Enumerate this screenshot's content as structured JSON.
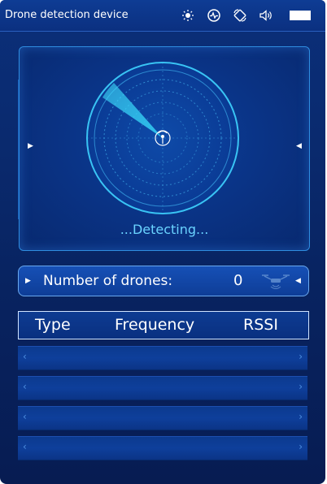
{
  "header": {
    "title": "Drone detection device",
    "icons": [
      "brightness-icon",
      "activity-icon",
      "rotate-icon",
      "volume-icon",
      "battery-icon"
    ]
  },
  "radar": {
    "status_text": "...Detecting...",
    "center_icon": "signal-icon"
  },
  "count": {
    "label": "Number of drones:",
    "value": "0",
    "icon": "drone-icon"
  },
  "table": {
    "columns": [
      "Type",
      "Frequency",
      "RSSI"
    ],
    "rows": [
      {
        "left": "‹",
        "right": "›"
      },
      {
        "left": "‹",
        "right": "›"
      },
      {
        "left": "‹",
        "right": "›"
      },
      {
        "left": "‹",
        "right": "›"
      }
    ]
  },
  "colors": {
    "background": "#0a2a6e",
    "accent": "#2fb8f0",
    "text": "#ffffff",
    "status_text": "#6ad3ff"
  }
}
